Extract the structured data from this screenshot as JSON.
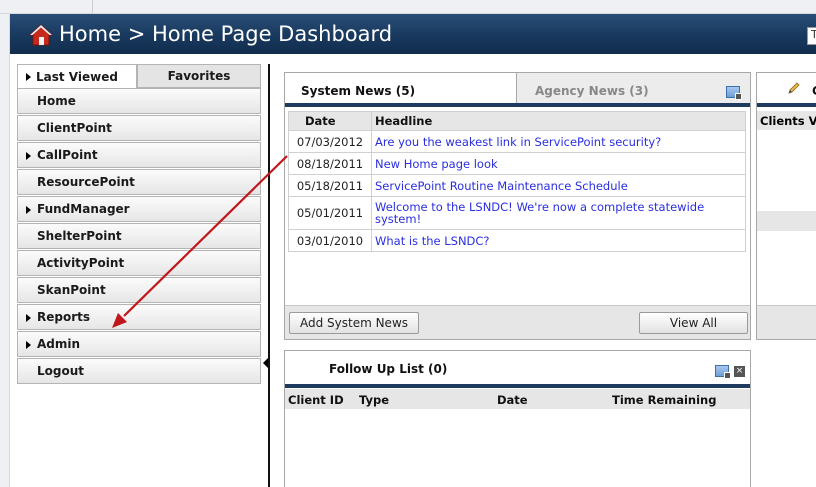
{
  "header": {
    "title": "Home > Home Page Dashboard",
    "search_partial": "Ty",
    "house_icon": "home-icon"
  },
  "nav": {
    "tabs": [
      {
        "label": "Last Viewed",
        "has_arrow": true
      },
      {
        "label": "Favorites",
        "has_arrow": false
      }
    ],
    "items": [
      {
        "label": "Home",
        "has_arrow": false
      },
      {
        "label": "ClientPoint",
        "has_arrow": false
      },
      {
        "label": "CallPoint",
        "has_arrow": true
      },
      {
        "label": "ResourcePoint",
        "has_arrow": false
      },
      {
        "label": "FundManager",
        "has_arrow": true
      },
      {
        "label": "ShelterPoint",
        "has_arrow": false
      },
      {
        "label": "ActivityPoint",
        "has_arrow": false
      },
      {
        "label": "SkanPoint",
        "has_arrow": false
      },
      {
        "label": "Reports",
        "has_arrow": true
      },
      {
        "label": "Admin",
        "has_arrow": true
      },
      {
        "label": "Logout",
        "has_arrow": false
      }
    ]
  },
  "news": {
    "tab_system": "System News (5)",
    "tab_agency": "Agency News (3)",
    "columns": {
      "date": "Date",
      "headline": "Headline"
    },
    "rows": [
      {
        "date": "07/03/2012",
        "headline": "Are you the weakest link in ServicePoint security?"
      },
      {
        "date": "08/18/2011",
        "headline": "New Home page look"
      },
      {
        "date": "05/18/2011",
        "headline": "ServicePoint Routine Maintenance Schedule"
      },
      {
        "date": "05/01/2011",
        "headline": "Welcome to the LSNDC! We're now a complete statewide system!"
      },
      {
        "date": "03/01/2010",
        "headline": "What is the LSNDC?"
      }
    ],
    "add_button": "Add System News",
    "view_all_button": "View All"
  },
  "clients_panel": {
    "tab_letter": "C",
    "column_header": "Clients V"
  },
  "follow_up": {
    "title": "Follow Up List (0)",
    "columns": [
      "Client ID",
      "Type",
      "Date",
      "Time Remaining"
    ]
  },
  "colors": {
    "header_bg": "#17375c",
    "accent_bar": "#1e3a5f",
    "link": "#2a2ee0",
    "annotation_arrow": "#c0171b"
  }
}
